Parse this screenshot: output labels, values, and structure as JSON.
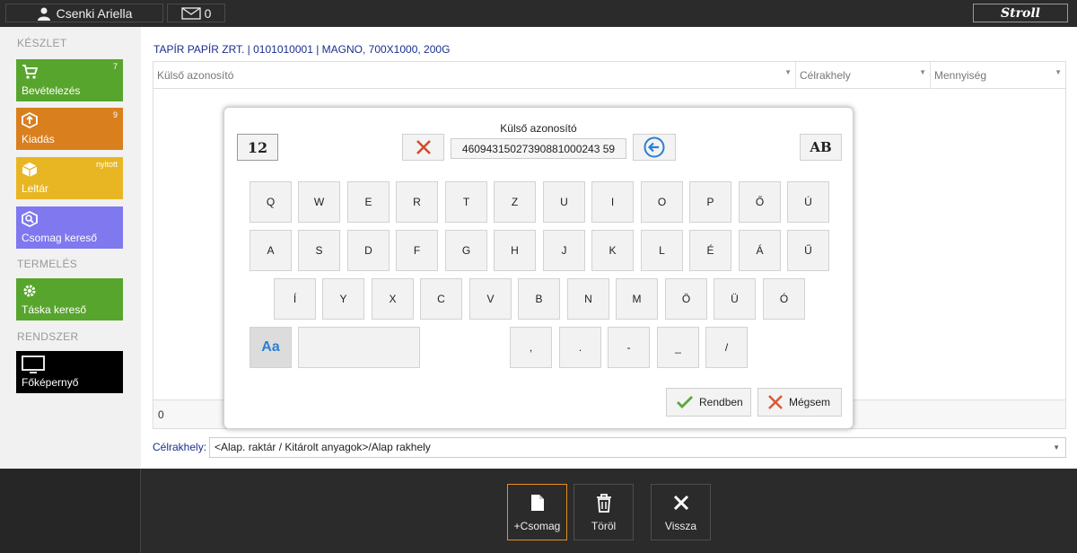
{
  "topbar": {
    "user_name": "Csenki Ariella",
    "message_count": "0",
    "logo": "Stroll"
  },
  "sidebar": {
    "sections": {
      "stock": "KÉSZLET",
      "production": "TERMELÉS",
      "system": "RENDSZER"
    },
    "tiles": [
      {
        "label": "Bevételezés",
        "badge": "7",
        "color": "#58a52d",
        "icon": "cart-icon"
      },
      {
        "label": "Kiadás",
        "badge": "9",
        "color": "#d97f1e",
        "icon": "box-out-icon"
      },
      {
        "label": "Leltár",
        "badge": "nyitott",
        "color": "#e8b623",
        "icon": "box-icon"
      },
      {
        "label": "Csomag kereső",
        "badge": "",
        "color": "#7f78ef",
        "icon": "package-search-icon"
      },
      {
        "label": "Táska kereső",
        "badge": "",
        "color": "#58a52d",
        "icon": "gear-icon"
      },
      {
        "label": "Főképernyő",
        "badge": "",
        "color": "#000000",
        "icon": "monitor-icon"
      }
    ]
  },
  "main": {
    "breadcrumb": "TAPÍR PAPÍR ZRT. | 0101010001 | MAGNO, 700X1000, 200G",
    "columns": [
      "Külső azonosító",
      "Célrakhely",
      "Mennyiség"
    ],
    "footer_count": "0",
    "target_label": "Célrakhely:",
    "target_value": "<Alap. raktár / Kitárolt anyagok>/Alap rakhely"
  },
  "keyboard": {
    "title": "Külső azonosító",
    "value": "46094315027390881000243 59",
    "numeric_toggle": "12",
    "upper_toggle": "AB",
    "case_toggle": "Aa",
    "row1": [
      "Q",
      "W",
      "E",
      "R",
      "T",
      "Z",
      "U",
      "I",
      "O",
      "P",
      "Ő",
      "Ú"
    ],
    "row2": [
      "A",
      "S",
      "D",
      "F",
      "G",
      "H",
      "J",
      "K",
      "L",
      "É",
      "Á",
      "Ű"
    ],
    "row3": [
      "Í",
      "Y",
      "X",
      "C",
      "V",
      "B",
      "N",
      "M",
      "Ö",
      "Ü",
      "Ó"
    ],
    "row4": [
      ",",
      ".",
      "-",
      "_",
      "/"
    ],
    "ok_label": "Rendben",
    "cancel_label": "Mégsem"
  },
  "bottom": {
    "buttons": [
      {
        "label": "+Csomag",
        "icon": "document-icon",
        "active": true
      },
      {
        "label": "Töröl",
        "icon": "trash-icon",
        "active": false
      },
      {
        "label": "Vissza",
        "icon": "close-icon",
        "active": false
      }
    ]
  },
  "colors": {
    "accent_blue": "#1a2f8c",
    "active_orange": "#e8901f",
    "ok_green": "#5aa83a",
    "cancel_red": "#d85a3a"
  }
}
